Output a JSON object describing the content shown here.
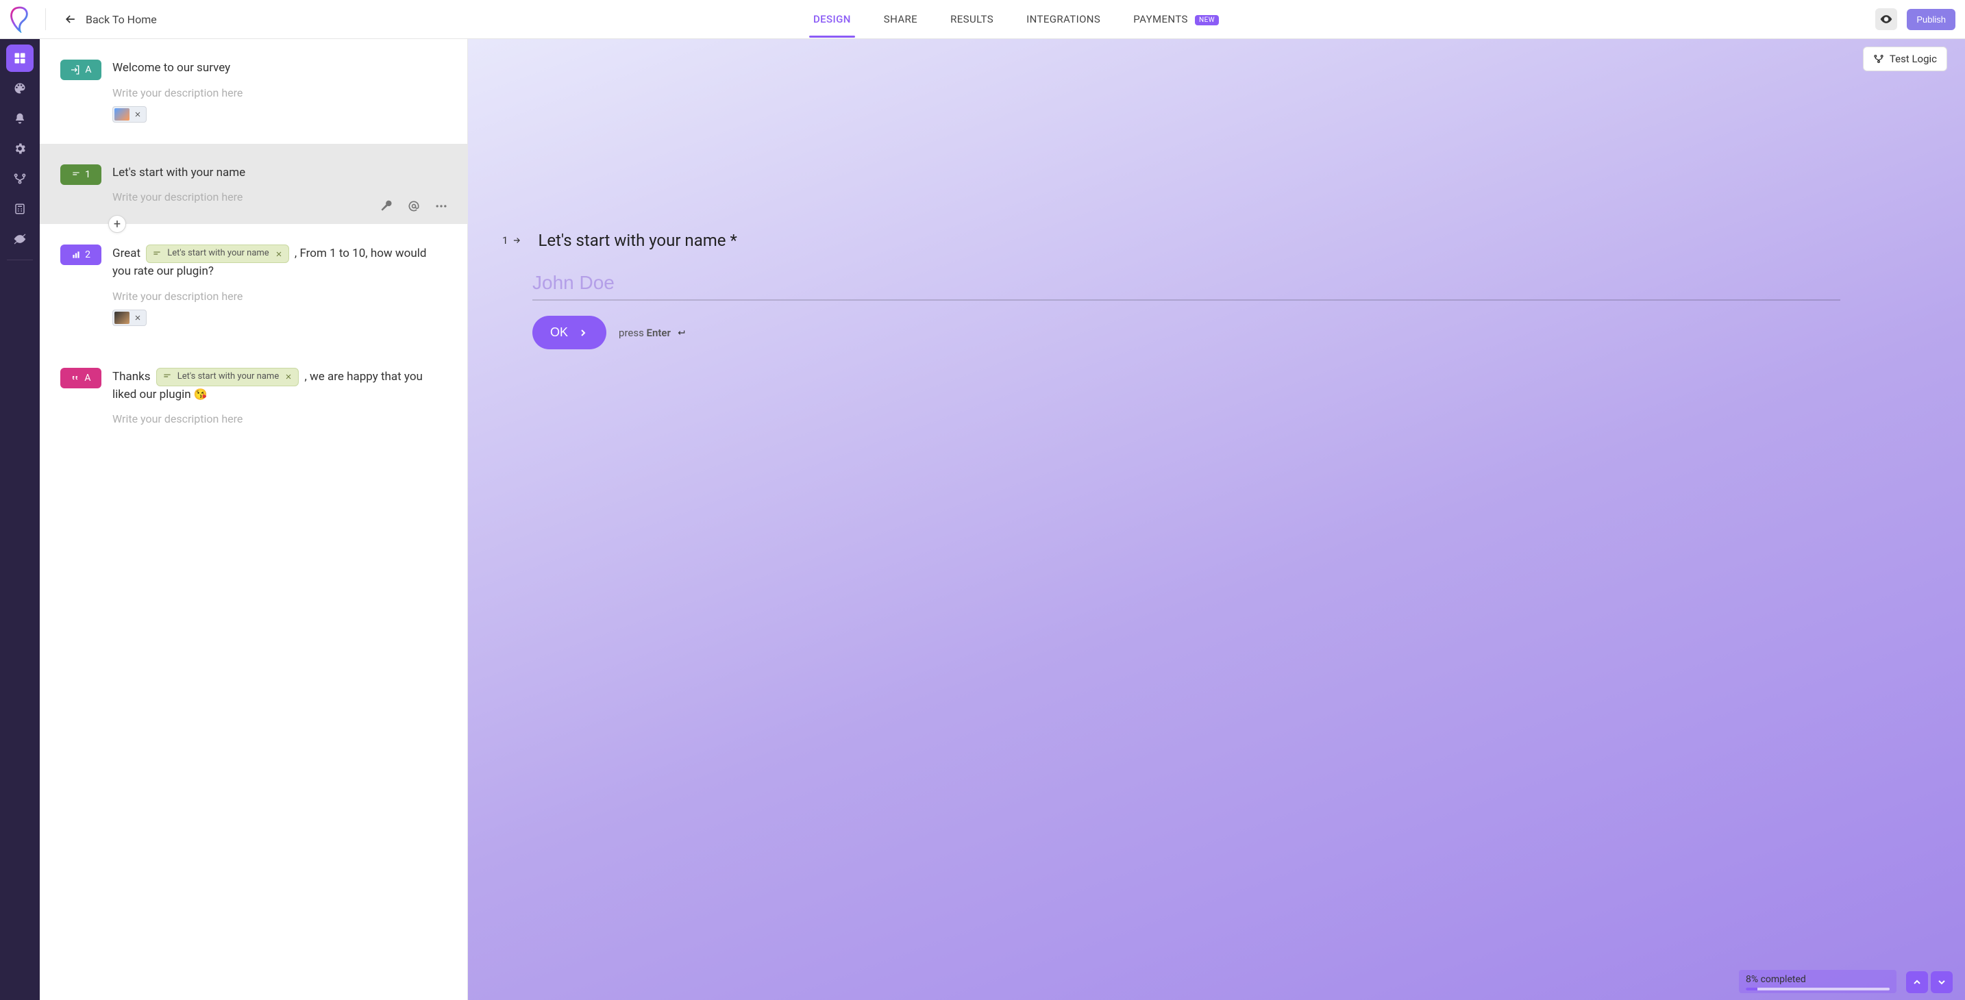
{
  "header": {
    "back_label": "Back To Home",
    "nav": {
      "design": "DESIGN",
      "share": "SHARE",
      "results": "RESULTS",
      "integrations": "INTEGRATIONS",
      "payments": "PAYMENTS",
      "payments_badge": "NEW"
    },
    "publish_label": "Publish"
  },
  "blocks": [
    {
      "badge_letter": "A",
      "title": "Welcome to our survey",
      "desc_placeholder": "Write your description here"
    },
    {
      "badge_letter": "1",
      "title": "Let's start with your name",
      "desc_placeholder": "Write your description here"
    },
    {
      "badge_letter": "2",
      "title_prefix": "Great ",
      "ref_label": "Let's start with your name",
      "title_suffix": ", From 1 to 10, how would you rate our plugin?",
      "desc_placeholder": "Write your description here"
    },
    {
      "badge_letter": "A",
      "title_prefix": "Thanks ",
      "ref_label": "Let's start with your name",
      "title_suffix": ", we are happy that you liked our plugin ",
      "emoji": "😘",
      "desc_placeholder": "Write your description here"
    }
  ],
  "preview": {
    "test_logic": "Test Logic",
    "q_number": "1",
    "q_title": "Let's start with your name *",
    "placeholder": "John Doe",
    "ok_label": "OK",
    "press_text": "press ",
    "enter_text": "Enter",
    "progress_label": "8% completed",
    "progress_percent": 8
  },
  "colors": {
    "accent": "#8B5CF6",
    "rail_bg": "#2B2344"
  }
}
